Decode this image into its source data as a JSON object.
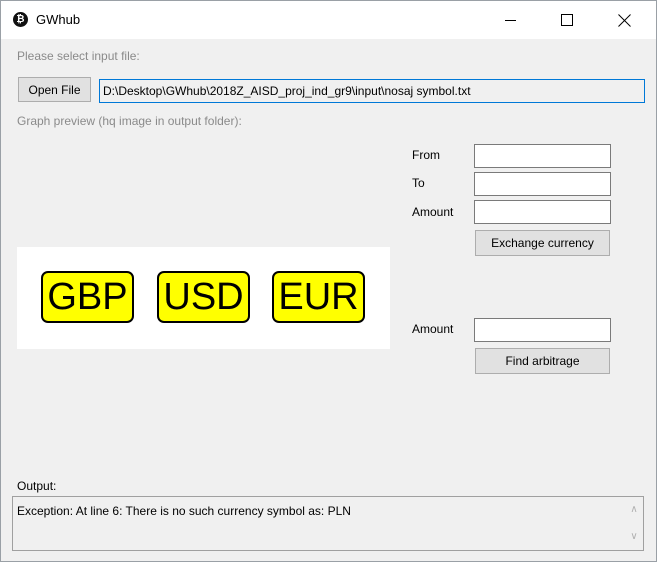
{
  "window": {
    "title": "GWhub",
    "icon": "bitcoin-icon",
    "icon_glyph": "₿"
  },
  "input_section": {
    "prompt": "Please select input file:",
    "open_button": "Open File",
    "path": "D:\\Desktop\\GWhub\\2018Z_AISD_proj_ind_gr9\\input\\nosaj symbol.txt"
  },
  "preview": {
    "label": "Graph preview (hq image in output folder):",
    "nodes": [
      "GBP",
      "USD",
      "EUR"
    ],
    "node_color": "#ffff00"
  },
  "exchange": {
    "from_label": "From",
    "from_value": "",
    "to_label": "To",
    "to_value": "",
    "amount_label": "Amount",
    "amount_value": "",
    "button": "Exchange currency"
  },
  "arbitrage": {
    "amount_label": "Amount",
    "amount_value": "",
    "button": "Find arbitrage"
  },
  "output": {
    "label": "Output:",
    "text": "Exception: At line 6: There is no such currency symbol as: PLN"
  },
  "colors": {
    "accent": "#0078d7",
    "window_bg": "#f0f0f0"
  }
}
